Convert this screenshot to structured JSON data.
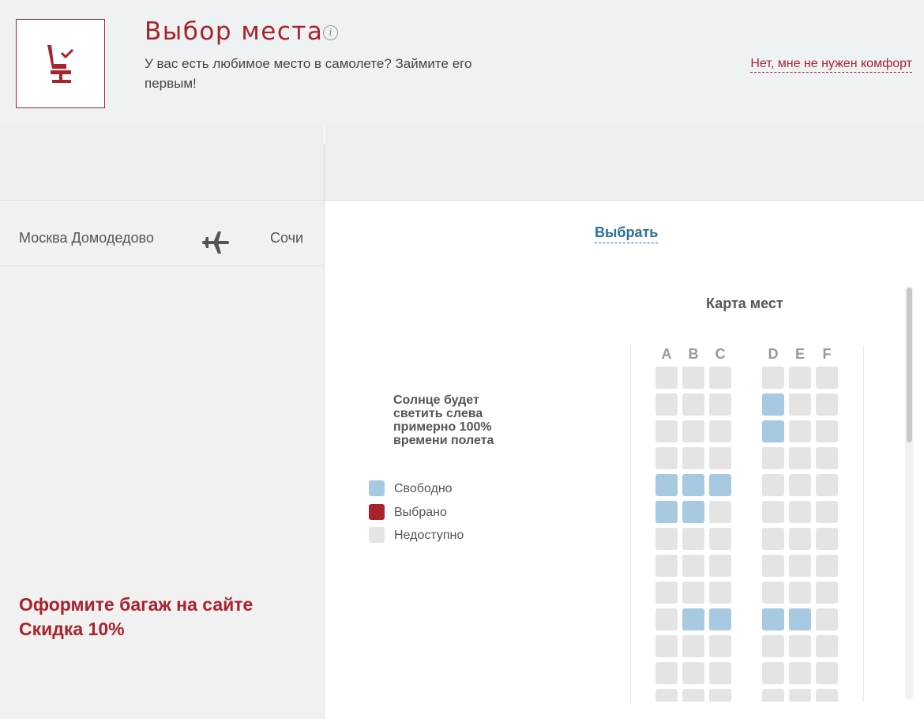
{
  "header": {
    "title": "Выбор места",
    "info_glyph": "i",
    "subtitle": "У вас есть любимое место в самолете? Займите его первым!",
    "decline_link": "Нет, мне не нужен комфорт",
    "icon": "seat-check-icon",
    "accent_color": "#a8232d"
  },
  "route": {
    "from": "Москва Домодедово",
    "to": "Сочи",
    "icon": "plane-icon"
  },
  "promo": {
    "line1": "Оформите багаж на сайте",
    "line2": "Скидка 10%"
  },
  "seat_panel": {
    "select_link": "Выбрать",
    "map_title": "Карта мест",
    "sun_note": "Солнце будет светить слева примерно 100% времени полета",
    "legend": [
      {
        "label": "Свободно",
        "status": "free",
        "color": "#a8c9e2"
      },
      {
        "label": "Выбрано",
        "status": "selected",
        "color": "#a8232d"
      },
      {
        "label": "Недоступно",
        "status": "unavailable",
        "color": "#e4e4e4"
      }
    ],
    "columns": [
      "A",
      "B",
      "C",
      "D",
      "E",
      "F"
    ],
    "rows": [
      [
        "x",
        "x",
        "x",
        "x",
        "x",
        "x"
      ],
      [
        "x",
        "x",
        "x",
        "f",
        "x",
        "x"
      ],
      [
        "x",
        "x",
        "x",
        "f",
        "x",
        "x"
      ],
      [
        "x",
        "x",
        "x",
        "x",
        "x",
        "x"
      ],
      [
        "f",
        "f",
        "f",
        "x",
        "x",
        "x"
      ],
      [
        "f",
        "f",
        "x",
        "x",
        "x",
        "x"
      ],
      [
        "x",
        "x",
        "x",
        "x",
        "x",
        "x"
      ],
      [
        "x",
        "x",
        "x",
        "x",
        "x",
        "x"
      ],
      [
        "x",
        "x",
        "x",
        "x",
        "x",
        "x"
      ],
      [
        "x",
        "f",
        "f",
        "f",
        "f",
        "x"
      ],
      [
        "x",
        "x",
        "x",
        "x",
        "x",
        "x"
      ],
      [
        "x",
        "x",
        "x",
        "x",
        "x",
        "x"
      ],
      [
        "x",
        "x",
        "x",
        "x",
        "x",
        "x"
      ]
    ]
  }
}
